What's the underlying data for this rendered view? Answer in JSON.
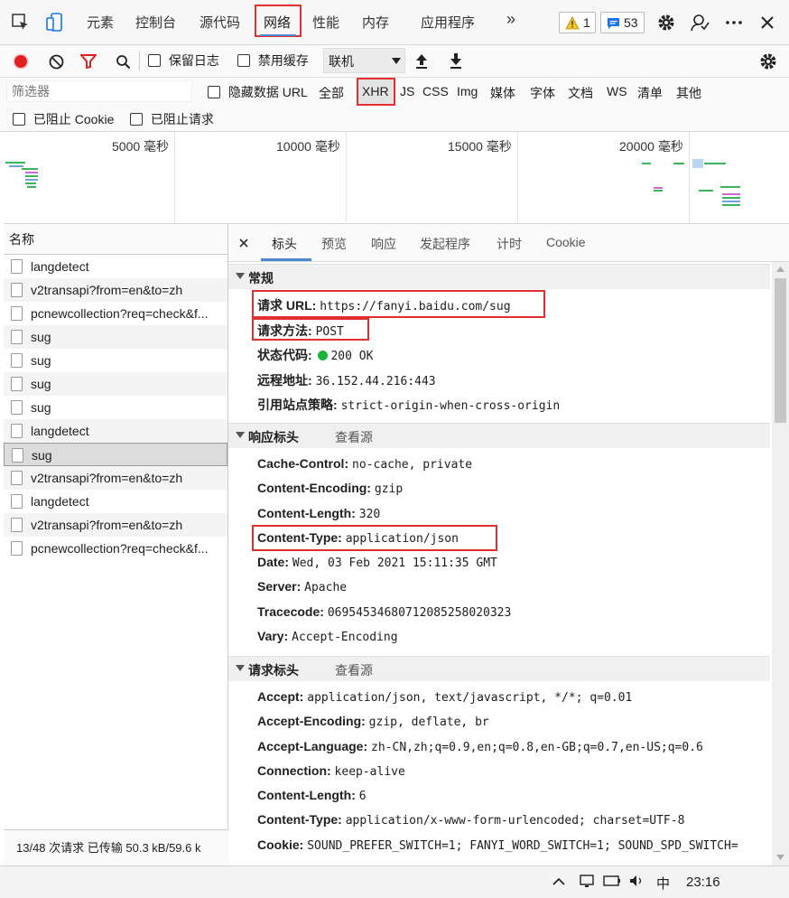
{
  "top_tabs": [
    "元素",
    "控制台",
    "源代码",
    "网络",
    "性能",
    "内存",
    "应用程序"
  ],
  "top_more": "»",
  "warnings_count": "1",
  "messages_count": "53",
  "toolbar": {
    "preserve_log": "保留日志",
    "disable_cache": "禁用缓存",
    "throttle": "联机"
  },
  "filter": {
    "placeholder": "筛选器",
    "hide_data_url": "隐藏数据 URL",
    "types": [
      "全部",
      "XHR",
      "JS",
      "CSS",
      "Img",
      "媒体",
      "字体",
      "文档",
      "WS",
      "清单",
      "其他"
    ],
    "blocked_cookie": "已阻止 Cookie",
    "blocked_requests": "已阻止请求"
  },
  "timeline_labels": [
    "5000 毫秒",
    "10000 毫秒",
    "15000 毫秒",
    "20000 毫秒"
  ],
  "list": {
    "header": "名称",
    "items": [
      "langdetect",
      "v2transapi?from=en&to=zh",
      "pcnewcollection?req=check&f...",
      "sug",
      "sug",
      "sug",
      "sug",
      "langdetect",
      "sug",
      "v2transapi?from=en&to=zh",
      "langdetect",
      "v2transapi?from=en&to=zh",
      "pcnewcollection?req=check&f..."
    ],
    "status": "13/48 次请求   已传输 50.3 kB/59.6 k"
  },
  "detail_tabs": [
    "标头",
    "预览",
    "响应",
    "发起程序",
    "计时",
    "Cookie"
  ],
  "general": {
    "title": "常规",
    "request_url_k": "请求 URL:",
    "request_url_v": "https://fanyi.baidu.com/sug",
    "method_k": "请求方法:",
    "method_v": "POST",
    "status_k": "状态代码:",
    "status_v": "200 OK",
    "remote_k": "远程地址:",
    "remote_v": "36.152.44.216:443",
    "referrer_k": "引用站点策略:",
    "referrer_v": "strict-origin-when-cross-origin"
  },
  "response_headers": {
    "title": "响应标头",
    "view_source": "查看源",
    "items": [
      {
        "k": "Cache-Control:",
        "v": "no-cache, private"
      },
      {
        "k": "Content-Encoding:",
        "v": "gzip"
      },
      {
        "k": "Content-Length:",
        "v": "320"
      },
      {
        "k": "Content-Type:",
        "v": "application/json"
      },
      {
        "k": "Date:",
        "v": "Wed, 03 Feb 2021 15:11:35 GMT"
      },
      {
        "k": "Server:",
        "v": "Apache"
      },
      {
        "k": "Tracecode:",
        "v": "06954534680712085258020323"
      },
      {
        "k": "Vary:",
        "v": "Accept-Encoding"
      }
    ]
  },
  "request_headers": {
    "title": "请求标头",
    "view_source": "查看源",
    "items": [
      {
        "k": "Accept:",
        "v": "application/json, text/javascript, */*; q=0.01"
      },
      {
        "k": "Accept-Encoding:",
        "v": "gzip, deflate, br"
      },
      {
        "k": "Accept-Language:",
        "v": "zh-CN,zh;q=0.9,en;q=0.8,en-GB;q=0.7,en-US;q=0.6"
      },
      {
        "k": "Connection:",
        "v": "keep-alive"
      },
      {
        "k": "Content-Length:",
        "v": "6"
      },
      {
        "k": "Content-Type:",
        "v": "application/x-www-form-urlencoded; charset=UTF-8"
      },
      {
        "k": "Cookie:",
        "v": "SOUND_PREFER_SWITCH=1; FANYI_WORD_SWITCH=1; SOUND_SPD_SWITCH="
      }
    ]
  },
  "taskbar": {
    "ime": "中",
    "time": "23:16"
  }
}
